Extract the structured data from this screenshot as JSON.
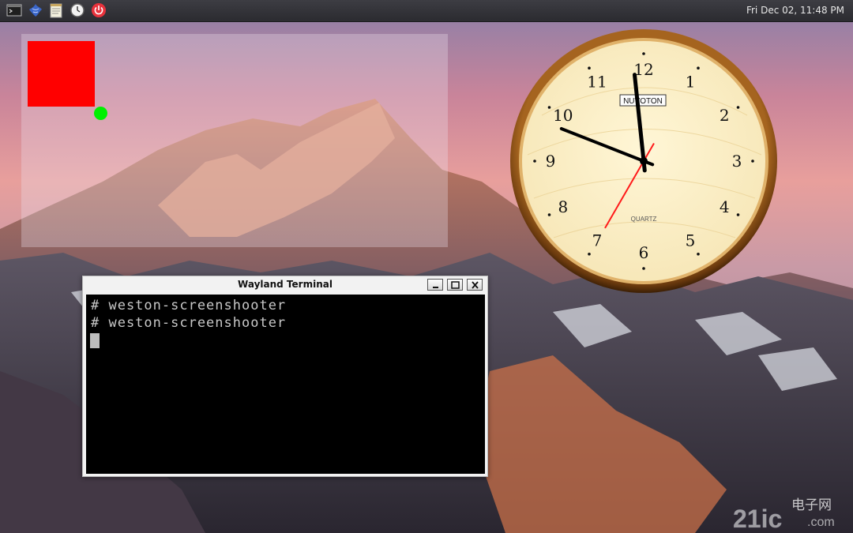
{
  "panel": {
    "launchers": [
      {
        "icon": "terminal-icon"
      },
      {
        "icon": "flower-icon"
      },
      {
        "icon": "notepad-icon"
      },
      {
        "icon": "clock-icon"
      },
      {
        "icon": "power-icon"
      }
    ],
    "datetime": "Fri Dec 02, 11:48 PM"
  },
  "analog_clock": {
    "brand": "NUVOTON",
    "movement": "QUARTZ",
    "numerals": [
      "12",
      "1",
      "2",
      "3",
      "4",
      "5",
      "6",
      "7",
      "8",
      "9",
      "10",
      "11"
    ],
    "time": {
      "hour": 11,
      "minute": 48,
      "second": 35
    },
    "colors": {
      "face": "#fbefc6",
      "rim": "#7a4512",
      "second_hand": "#ff1a1a",
      "hands": "#000000"
    }
  },
  "demo_surface": {
    "colors": {
      "square": "#ff0000",
      "dot": "#00f000"
    }
  },
  "terminal": {
    "title": "Wayland Terminal",
    "lines": [
      "# weston-screenshooter",
      "# weston-screenshooter"
    ]
  },
  "watermark": {
    "text_cn": "电子网",
    "text_en": "21ic",
    "domain": ".com"
  }
}
